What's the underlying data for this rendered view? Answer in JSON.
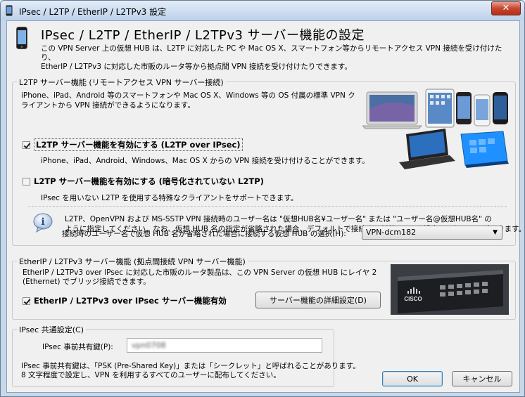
{
  "window": {
    "title": "IPsec / L2TP / EtherIP / L2TPv3 設定",
    "close_label": "✕"
  },
  "header": {
    "title": "IPsec / L2TP / EtherIP / L2TPv3 サーバー機能の設定",
    "desc_line1": "この VPN Server 上の仮想 HUB は、L2TP に対応した PC や Mac OS X、スマートフォン等からリモートアクセス VPN 接続を受け付けたり、",
    "desc_line2": "EtherIP / L2TPv3 に対応した市販のルータ等から拠点間 VPN 接続を受け付けたりできます。"
  },
  "l2tp_group": {
    "label": "L2TP サーバー機能 (リモートアクセス VPN サーバー接続)",
    "intro_line1": "iPhone、iPad、Android 等のスマートフォンや Mac OS X、Windows 等の OS 付属の標準 VPN ク",
    "intro_line2": "ライアントから VPN 接続ができるようになります。",
    "chk_ipsec_label": "L2TP サーバー機能を有効にする (L2TP over IPsec)",
    "chk_ipsec_checked": true,
    "chk_ipsec_desc": "iPhone、iPad、Android、Windows、Mac OS X からの VPN 接続を受け付けることができます。",
    "chk_raw_label": "L2TP サーバー機能を有効にする (暗号化されていない L2TP)",
    "chk_raw_checked": false,
    "chk_raw_desc": "IPsec を用いない L2TP を使用する特殊なクライアントをサポートできます。",
    "info_line1": "L2TP、OpenVPN および MS-SSTP VPN 接続時のユーザー名は \"仮想HUB名¥ユーザー名\" または \"ユーザー名@仮想HUB名\" の",
    "info_line2": "ように指定してください。なお、仮想 HUB 名の指定が省略された場合、デフォルトで接続する仮想 HUB を設定しておくことができます。",
    "hub_select_label": "接続時のユーザー名で仮想 HUB 名が省略された場合に接続する仮想 HUB の選択(H):",
    "hub_select_value": "VPN-dcm182"
  },
  "etherip_group": {
    "label": "EtherIP / L2TPv3 サーバー機能 (拠点間接続 VPN サーバー機能)",
    "desc_line1": "EtherIP / L2TPv3 over IPsec に対応した市販のルータ製品は、この VPN Server の仮想 HUB にレイヤ 2",
    "desc_line2": "(Ethernet) でブリッジ接続できます。",
    "chk_label": "EtherIP / L2TPv3 over IPsec サーバー機能有効",
    "chk_checked": true,
    "detail_button": "サーバー機能の詳細設定(D)",
    "router_brand": "CISCO"
  },
  "ipsec_group": {
    "label": "IPsec 共通設定(C)",
    "psk_label": "IPsec 事前共有鍵(P):",
    "psk_value": "vpn0708",
    "note_line1": "IPsec 事前共有鍵は、「PSK (Pre-Shared Key)」または「シークレット」と呼ばれることがあります。",
    "note_line2": "8 文字程度で設定し、VPN を利用するすべてのユーザーに配布してください。"
  },
  "footer": {
    "ok_label": "OK",
    "cancel_label": "キャンセル"
  },
  "colors": {
    "win8_tablet": "#1e90ff",
    "laptop_screen": "#4a6fa5",
    "close_red": "#c7452f"
  }
}
